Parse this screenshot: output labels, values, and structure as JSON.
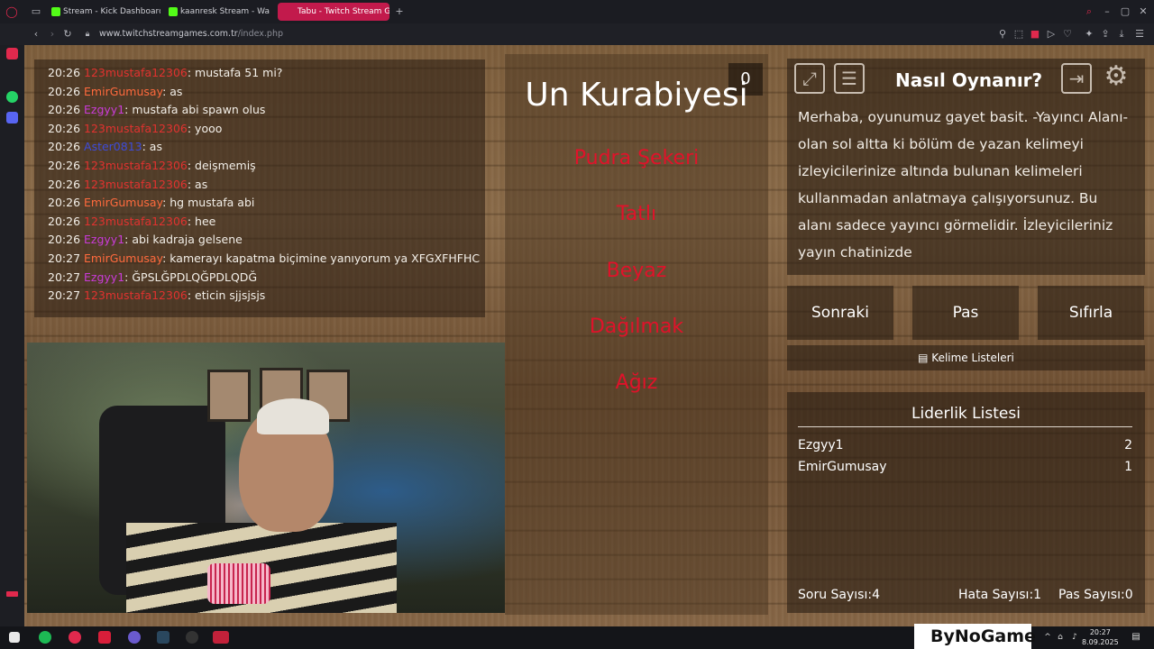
{
  "browser": {
    "tabs": [
      {
        "label": "Stream - Kick Dashboard",
        "color": "#53fc18"
      },
      {
        "label": "kaanresk Stream - Wa",
        "color": "#53fc18"
      },
      {
        "label": "Tabu - Twitch Stream Gar",
        "color": "#c21a4c",
        "active": true
      }
    ],
    "url_host": "www.twitchstreamgames.com.tr",
    "url_path": "/index.php"
  },
  "chat": {
    "messages": [
      {
        "time": "20:26",
        "user": "123mustafa12306",
        "color": "#e0322f",
        "text": ": mustafa 51 mi?"
      },
      {
        "time": "20:26",
        "user": "EmirGumusay",
        "color": "#ff6a3d",
        "text": ": as"
      },
      {
        "time": "20:26",
        "user": "Ezgyy1",
        "color": "#c93bd8",
        "text": ": mustafa abi spawn olus"
      },
      {
        "time": "20:26",
        "user": "123mustafa12306",
        "color": "#e0322f",
        "text": ": yooo"
      },
      {
        "time": "20:26",
        "user": "Aster0813",
        "color": "#3d4bd8",
        "text": ": as"
      },
      {
        "time": "20:26",
        "user": "123mustafa12306",
        "color": "#e0322f",
        "text": ": deişmemiş"
      },
      {
        "time": "20:26",
        "user": "123mustafa12306",
        "color": "#e0322f",
        "text": ": as"
      },
      {
        "time": "20:26",
        "user": "EmirGumusay",
        "color": "#ff6a3d",
        "text": ": hg mustafa abi"
      },
      {
        "time": "20:26",
        "user": "123mustafa12306",
        "color": "#e0322f",
        "text": ": hee"
      },
      {
        "time": "20:26",
        "user": "Ezgyy1",
        "color": "#c93bd8",
        "text": ": abi kadraja gelsene"
      },
      {
        "time": "20:27",
        "user": "EmirGumusay",
        "color": "#ff6a3d",
        "text": ": kamerayı kapatma biçimine yanıyorum ya XFGXFHFHC"
      },
      {
        "time": "20:27",
        "user": "Ezgyy1",
        "color": "#c93bd8",
        "text": ": ĞPSLĞPDLQĞPDLQDĞ"
      },
      {
        "time": "20:27",
        "user": "123mustafa12306",
        "color": "#e0322f",
        "text": ": eticin sjjsjsjs"
      }
    ]
  },
  "card": {
    "counter": "0",
    "word": "Un Kurabiyesi",
    "forbidden": [
      "Pudra Şekeri",
      "Tatlı",
      "Beyaz",
      "Dağılmak",
      "Ağız"
    ]
  },
  "how": {
    "title": "Nasıl Oynanır?",
    "text": "Merhaba, oyunumuz gayet basit. -Yayıncı Alanı- olan sol altta ki bölüm de yazan kelimeyi izleyicilerinize altında bulunan kelimeleri kullanmadan anlatmaya çalışıyorsunuz. Bu alanı sadece yayıncı görmelidir. İzleyicileriniz yayın chatinizde"
  },
  "buttons": {
    "next": "Sonraki",
    "pass": "Pas",
    "reset": "Sıfırla",
    "word_lists": "Kelime Listeleri"
  },
  "leaderboard": {
    "title": "Liderlik Listesi",
    "rows": [
      {
        "name": "Ezgyy1",
        "score": "2"
      },
      {
        "name": "EmirGumusay",
        "score": "1"
      }
    ],
    "questions_label": "Soru Sayısı:",
    "questions": "4",
    "errors_label": "Hata Sayısı:",
    "errors": "1",
    "passes_label": "Pas Sayısı:",
    "passes": "0"
  },
  "taskbar": {
    "brand": "ByNoGame",
    "time": "20:27",
    "date": "8.09.2025"
  }
}
